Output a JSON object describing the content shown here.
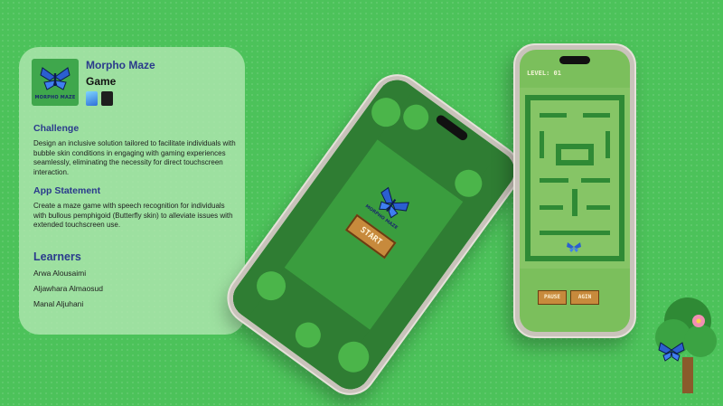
{
  "app": {
    "name": "Morpho Maze",
    "category": "Game",
    "icon_caption": "MORPHO MAZE",
    "tools": [
      "swift-icon",
      "figma-icon"
    ]
  },
  "challenge": {
    "heading": "Challenge",
    "text": "Design an inclusive solution tailored to facilitate individuals with bubble skin conditions in engaging with gaming experiences seamlessly, eliminating the necessity for direct touchscreen interaction."
  },
  "app_statement": {
    "heading": "App Statement",
    "text": "Create a maze game with speech recognition for individuals with bullous pemphigoid (Butterfly skin) to alleviate issues with extended touchscreen use."
  },
  "learners": {
    "heading": "Learners",
    "names": [
      "Arwa Alousaimi",
      "Aljawhara Almaosud",
      "Manal Aljuhani"
    ]
  },
  "phone_start": {
    "title": "MORPHO MAZE",
    "start_label": "START"
  },
  "phone_game": {
    "level_label": "LEVEL: 01",
    "pause_label": "PAUSE",
    "again_label": "AGIN"
  },
  "colors": {
    "background": "#4cc25a",
    "card": "#b0e7b0",
    "heading": "#2a3a8c",
    "button": "#c78a3c"
  }
}
